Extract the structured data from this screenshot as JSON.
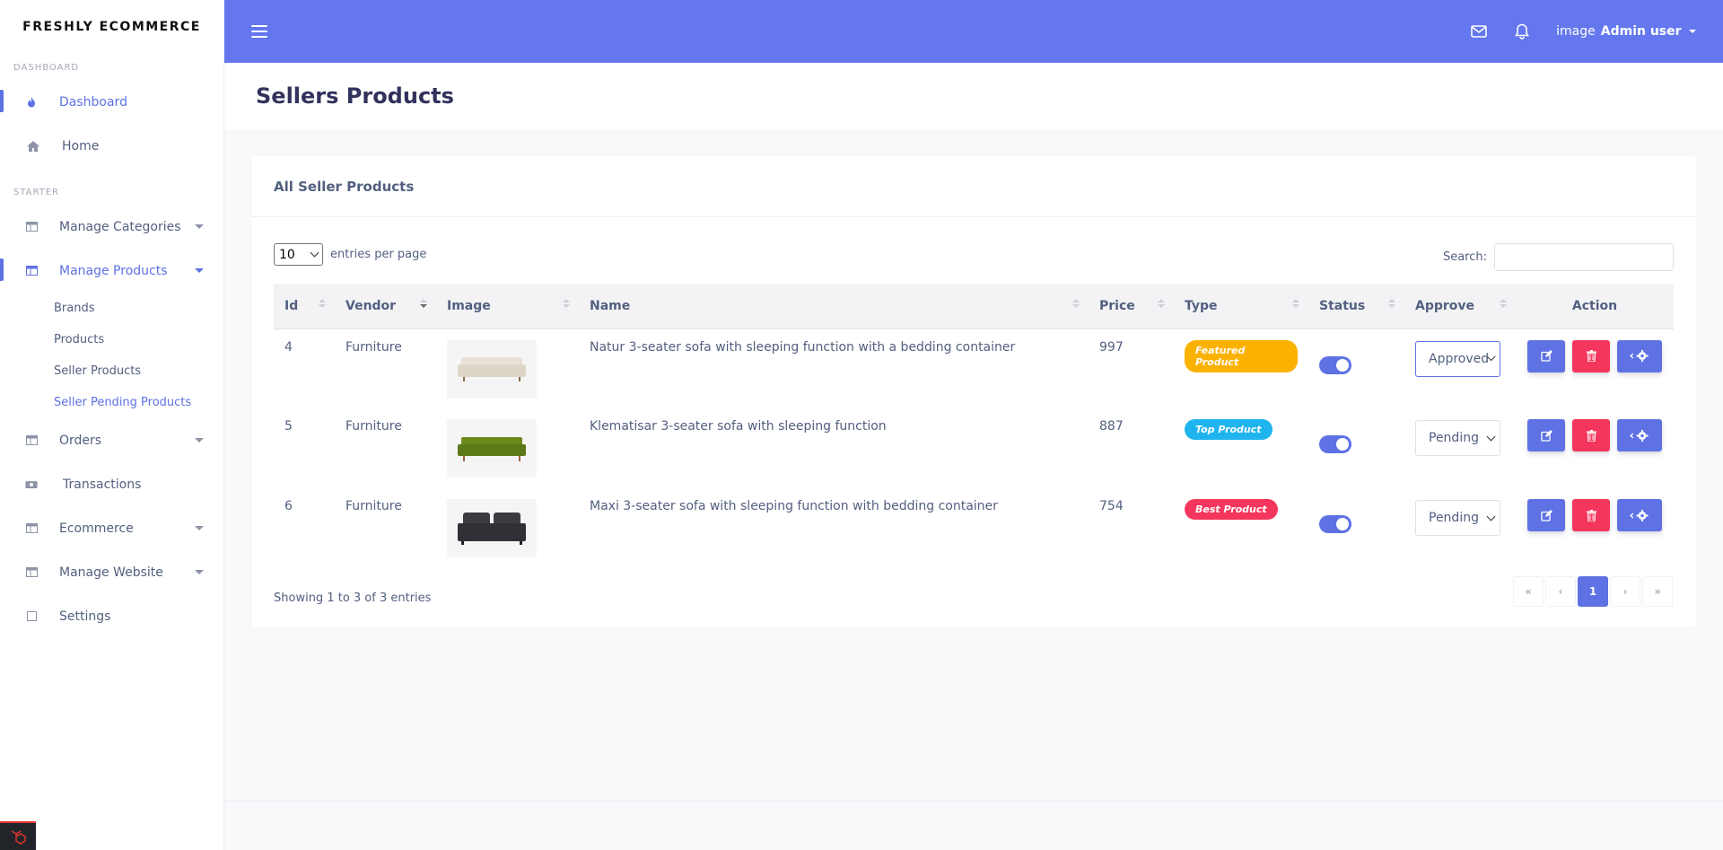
{
  "brand": "FRESHLY ECOMMERCE",
  "sidebar": {
    "heading_dashboard": "DASHBOARD",
    "heading_starter": "STARTER",
    "dashboard": "Dashboard",
    "home": "Home",
    "manage_categories": "Manage Categories",
    "manage_products": "Manage Products",
    "sub_products": [
      "Brands",
      "Products",
      "Seller Products",
      "Seller Pending Products"
    ],
    "orders": "Orders",
    "transactions": "Transactions",
    "ecommerce": "Ecommerce",
    "manage_website": "Manage Website",
    "settings": "Settings"
  },
  "topbar": {
    "user_image_alt": "image",
    "user_name": "Admin user"
  },
  "page": {
    "title": "Sellers Products",
    "card_title": "All Seller Products",
    "entries_value": "10",
    "entries_label": "entries per page",
    "search_label": "Search:",
    "showing": "Showing 1 to 3 of 3 entries"
  },
  "table": {
    "headers": [
      "Id",
      "Vendor",
      "Image",
      "Name",
      "Price",
      "Type",
      "Status",
      "Approve",
      "Action"
    ],
    "rows": [
      {
        "id": "4",
        "vendor": "Furniture",
        "name": "Natur 3-seater sofa with sleeping function with a bedding container",
        "price": "997",
        "type": "Featured Product",
        "type_color": "#fbb100",
        "approve": "Approved",
        "sofa_color": "#e8e1d6"
      },
      {
        "id": "5",
        "vendor": "Furniture",
        "name": "Klematisar 3-seater sofa with sleeping function",
        "price": "887",
        "type": "Top Product",
        "type_color": "#1fb4ee",
        "approve": "Pending",
        "sofa_color": "#6b8a1e"
      },
      {
        "id": "6",
        "vendor": "Furniture",
        "name": "Maxi 3-seater sofa with sleeping function with bedding container",
        "price": "754",
        "type": "Best Product",
        "type_color": "#f5365c",
        "approve": "Pending",
        "sofa_color": "#3a3c42"
      }
    ]
  },
  "pagination": [
    "«",
    "‹",
    "1",
    "›",
    "»"
  ],
  "colors": {
    "accent": "#5e72e4",
    "topbar": "#6477ee",
    "danger": "#f5365c"
  }
}
